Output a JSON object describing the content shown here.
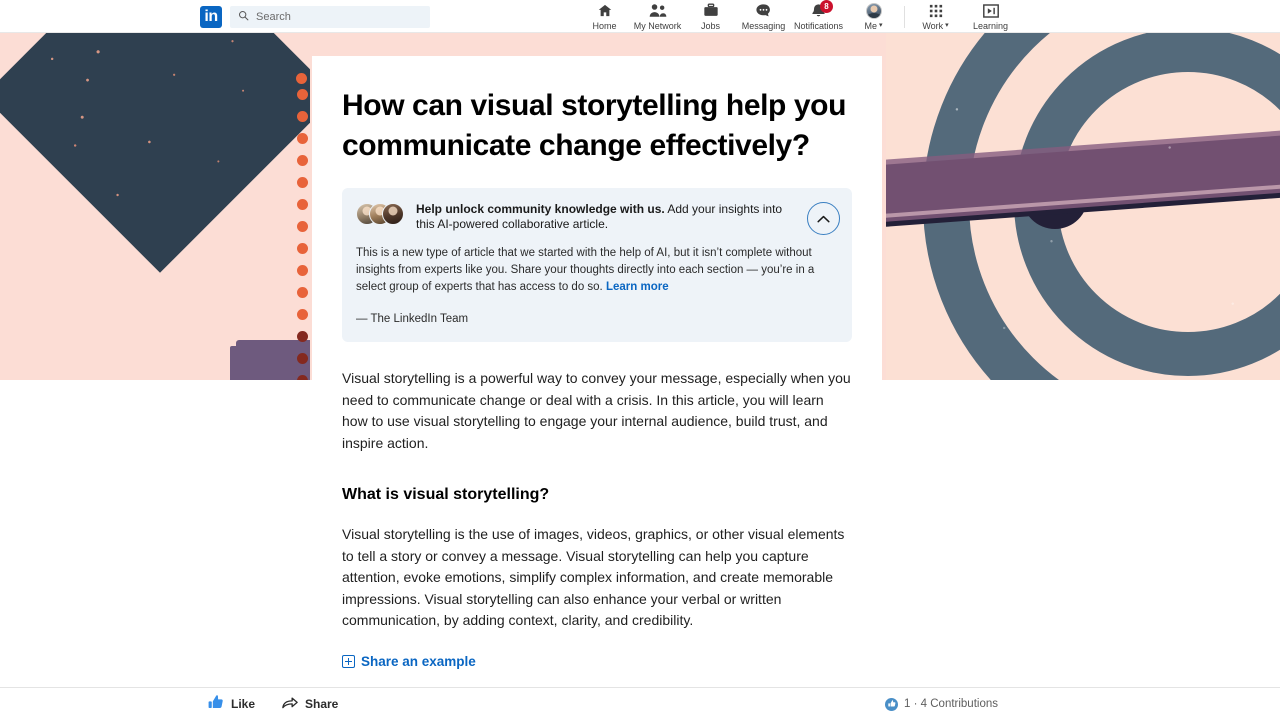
{
  "nav": {
    "logo_text": "in",
    "search": {
      "placeholder": "Search",
      "value": "",
      "icon": "search-icon"
    },
    "items": [
      {
        "label": "Home",
        "icon": "home-icon",
        "badge": ""
      },
      {
        "label": "My Network",
        "icon": "people-icon",
        "badge": ""
      },
      {
        "label": "Jobs",
        "icon": "briefcase-icon",
        "badge": ""
      },
      {
        "label": "Messaging",
        "icon": "message-bubble-icon",
        "badge": ""
      },
      {
        "label": "Notifications",
        "icon": "bell-icon",
        "badge": "8"
      }
    ],
    "me": {
      "label": "Me",
      "caret": "▾",
      "icon": "avatar-icon"
    },
    "work": {
      "label": "Work",
      "caret": "▾",
      "icon": "grid-apps-icon"
    },
    "learning": {
      "label": "Learning",
      "icon": "learning-play-icon"
    }
  },
  "article": {
    "title": "How can visual storytelling help you communicate change effectively?",
    "paragraph_1": "Visual storytelling is a powerful way to convey your message, especially when you need to communicate change or deal with a crisis. In this article, you will learn how to use visual storytelling to engage your internal audience, build trust, and inspire action.",
    "section_1_heading": "What is visual storytelling?",
    "section_1_paragraph": "Visual storytelling is the use of images, videos, graphics, or other visual elements to tell a story or convey a message. Visual storytelling can help you capture attention, evoke emotions, simplify complex information, and create memorable impressions. Visual storytelling can also enhance your verbal or written communication, by adding context, clarity, and credibility.",
    "share_example_label": "Share an example"
  },
  "banner": {
    "headline_bold": "Help unlock community knowledge with us.",
    "headline_rest": " Add your insights into this AI-powered collaborative article.",
    "body_before_link": "This is a new type of article that we started with the help of AI, but it isn’t complete without insights from experts like you. Share your thoughts directly into each section — you’re in a select group of experts that has access to do so. ",
    "learn_more_label": "Learn more",
    "signoff": "— The LinkedIn Team",
    "collapse_icon": "chevron-up-icon"
  },
  "footer": {
    "like_label": "Like",
    "like_icon": "thumbs-up-icon",
    "share_label": "Share",
    "share_icon": "share-arrow-icon",
    "contributions_label": "1 · 4 Contributions",
    "contributions_icon": "thumbs-up-circle-icon"
  },
  "colors": {
    "linkedin_blue": "#0a66c2",
    "badge_red": "#cb112d",
    "hero_pink": "#fcddd5",
    "dot_orange": "#e8633a",
    "dot_dark": "#84291f",
    "ink_navy": "#2f4050",
    "ring_slate": "#546a7b",
    "stripe_purple": "#865d80",
    "banner_bg": "#eef3f8"
  }
}
